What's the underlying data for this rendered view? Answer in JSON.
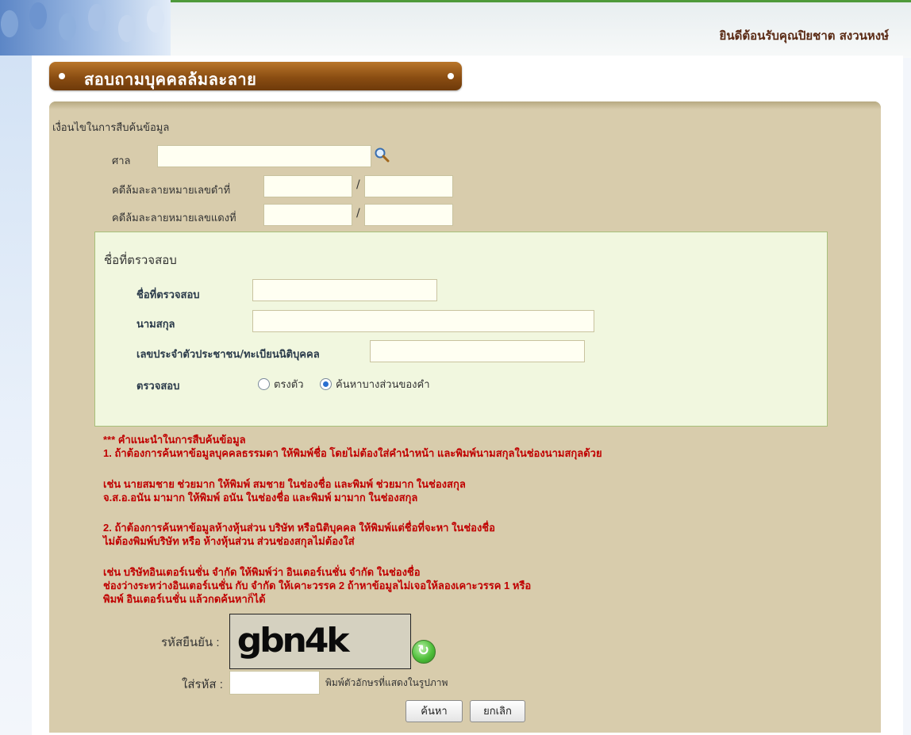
{
  "header": {
    "welcome": "ยินดีต้อนรับคุณปิยชาต สงวนหงษ์"
  },
  "page": {
    "title": "สอบถามบุคคลล้มละลาย"
  },
  "criteria": {
    "section_label": "เงื่อนไขในการสืบค้นข้อมูล",
    "court_label": "ศาล",
    "black_case_label": "คดีล้มละลายหมายเลขดำที่",
    "red_case_label": "คดีล้มละลายหมายเลขแดงที่",
    "slash": "/"
  },
  "name_check": {
    "legend": "ชื่อที่ตรวจสอบ",
    "name_label": "ชื่อที่ตรวจสอบ",
    "surname_label": "นามสกุล",
    "id_label": "เลขประจำตัวประชาชน/ทะเบียนนิติบุคคล",
    "mode_label": "ตรวจสอบ",
    "option_exact": "ตรงตัว",
    "option_partial": "ค้นหาบางส่วนของคำ",
    "selected_option": "ค้นหาบางส่วนของคำ"
  },
  "instructions": {
    "heading": "*** คำแนะนำในการสืบค้นข้อมูล",
    "line1": "1. ถ้าต้องการค้นหาข้อมูลบุคคลธรรมดา ให้พิมพ์ชื่อ โดยไม่ต้องใส่คำนำหน้า และพิมพ์นามสกุลในช่องนามสกุลด้วย",
    "line2": "เช่น นายสมชาย ช่วยมาก ให้พิมพ์ สมชาย ในช่องชื่อ และพิมพ์ ช่วยมาก ในช่องสกุล",
    "line3": "จ.ส.อ.อนัน มามาก ให้พิมพ์ อนัน ในช่องชื่อ และพิมพ์ มามาก ในช่องสกุล",
    "line4": "2. ถ้าต้องการค้นหาข้อมูลห้างหุ้นส่วน บริษัท หรือนิติบุคคล ให้พิมพ์แต่ชื่อที่จะหา ในช่องชื่อ",
    "line5": "ไม่ต้องพิมพ์บริษัท หรือ ห้างหุ้นส่วน ส่วนช่องสกุลไม่ต้องใส่",
    "line6": "เช่น บริษัทอินเตอร์เนชั่น จำกัด ให้พิมพ์ว่า อินเตอร์เนชั่น จำกัด ในช่องชื่อ",
    "line7": "ช่องว่างระหว่างอินเตอร์เนชั่น กับ จำกัด ให้เคาะวรรค 2 ถ้าหาข้อมูลไม่เจอให้ลองเคาะวรรค 1 หรือ",
    "line8": "พิมพ์ อินเตอร์เนชั่น แล้วกดค้นหาก็ได้"
  },
  "captcha": {
    "label": "รหัสยืนยัน :",
    "image_text": "gbn4k",
    "input_label": "ใส่รหัส :",
    "hint": "พิมพ์ตัวอักษรที่แสดงในรูปภาพ"
  },
  "buttons": {
    "search": "ค้นหา",
    "cancel": "ยกเลิก"
  }
}
